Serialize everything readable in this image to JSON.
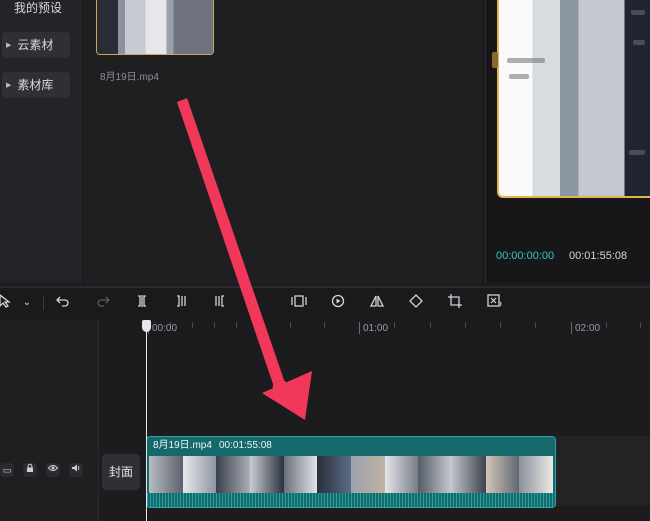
{
  "sidebar": {
    "items": [
      {
        "label": "我的预设"
      },
      {
        "label": "云素材"
      },
      {
        "label": "素材库"
      }
    ]
  },
  "media": {
    "file_name": "8月19日.mp4"
  },
  "preview": {
    "current_time": "00:00:00:00",
    "total_time": "00:01:55:08"
  },
  "toolbar": {
    "icons": [
      "select-icon",
      "chevron-down-icon",
      "undo-icon",
      "redo-icon",
      "split-icon",
      "trim-left-icon",
      "trim-right-icon",
      "freeze-frame-icon",
      "reverse-icon",
      "mirror-icon",
      "rotate-icon",
      "crop-icon",
      "ai-cutout-icon"
    ]
  },
  "timeline": {
    "ruler": [
      "00:00",
      "01:00",
      "02:00"
    ],
    "cover_label": "封面",
    "clip": {
      "name": "8月19日.mp4",
      "duration": "00:01:55:08"
    }
  },
  "colors": {
    "accent_cyan": "#2fc7c7",
    "selection_gold": "#e2b64e",
    "clip_teal": "#16696b",
    "annotation_arrow": "#f2385a"
  }
}
